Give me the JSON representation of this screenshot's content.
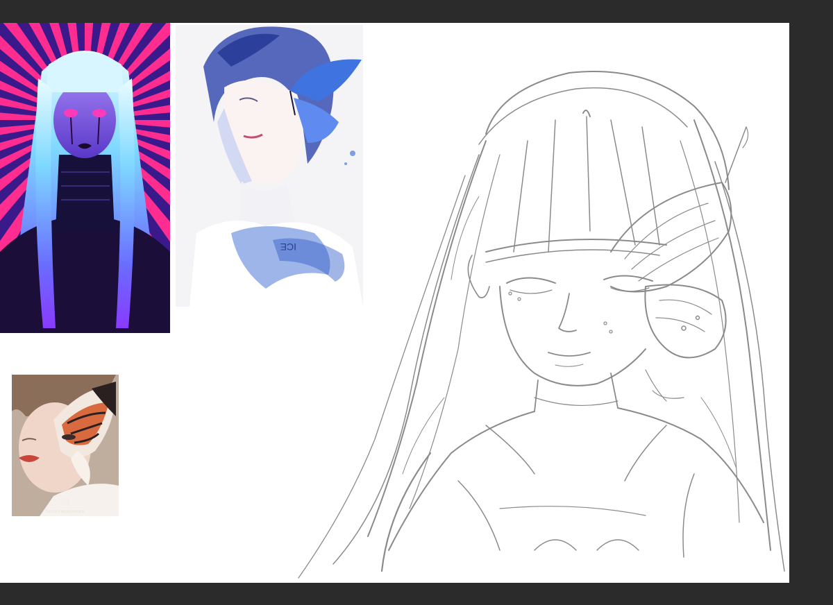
{
  "workspace": {
    "background_color": "#2b2b2b",
    "canvas_color": "#ffffff"
  },
  "references": [
    {
      "name": "reference-image-purple-hair-girl",
      "subject": "girl with long blue-white hair on pink and purple sunburst",
      "colors": {
        "burst_a": "#ff2d8f",
        "burst_b": "#3a1a8a",
        "hair": "#7ed8ff",
        "skin": "#6a4ad8"
      }
    },
    {
      "name": "reference-image-butterfly-boy",
      "subject": "watercolor boy with blue butterfly",
      "text": "ICE",
      "colors": {
        "wash": "#4e78d8",
        "hair": "#2c3f9a",
        "paper": "#f4f4f6"
      }
    },
    {
      "name": "reference-image-butterfly-makeup",
      "subject": "woman with butterfly wing makeup",
      "mark": "M",
      "caption": "DEEPLY MEMORABLE",
      "colors": {
        "bg": "#c9b8a8",
        "wing_orange": "#d96a40",
        "wing_black": "#2a2020"
      }
    }
  ],
  "sketch": {
    "name": "pencil-sketch-girl-with-butterfly",
    "stroke_color": "#8a8a8a"
  }
}
